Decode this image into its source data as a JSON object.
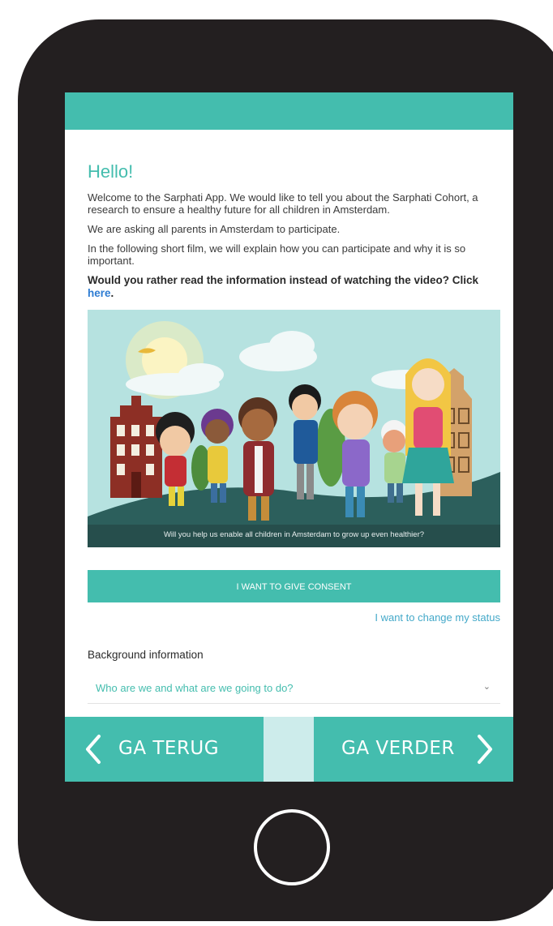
{
  "header": {
    "color": "#44bdae"
  },
  "intro": {
    "title": "Hello!",
    "p1": "Welcome to the Sarphati App. We would like to tell you about the Sarphati Cohort, a research to ensure a healthy future for all children in Amsterdam.",
    "p2": "We are asking all parents in Amsterdam to participate.",
    "p3": "In the following short film, we will explain how you can participate and why it is so important.",
    "read_prompt": "Would you rather read the information instead of watching the video? Click ",
    "read_link": "here",
    "read_end": "."
  },
  "video": {
    "caption": "Will you help us enable all children in Amsterdam to grow up even healthier?"
  },
  "actions": {
    "consent_label": "I WANT TO GIVE CONSENT",
    "status_link": "I want to change my status"
  },
  "background": {
    "heading": "Background information",
    "items": [
      {
        "label": "Who are we and what are we going to do?",
        "icon": "chevron-down-icon"
      }
    ]
  },
  "bottom_nav": {
    "back_label": "GA TERUG",
    "next_label": "GA VERDER",
    "back_icon": "chevron-left-icon",
    "next_icon": "chevron-right-icon"
  },
  "colors": {
    "accent": "#44bdae",
    "link": "#2f7dd3",
    "frame": "#231f20"
  }
}
